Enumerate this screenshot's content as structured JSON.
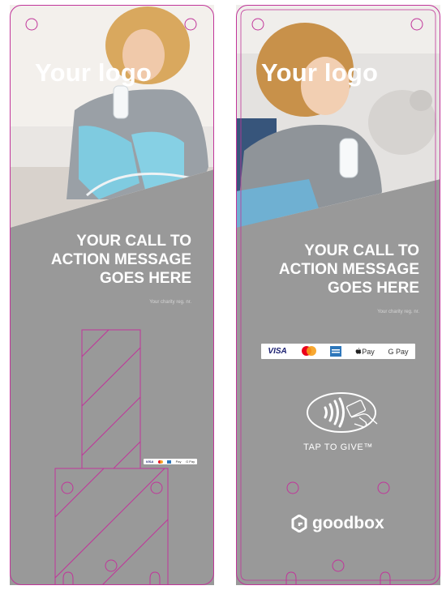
{
  "left_panel": {
    "logo_text": "Your logo",
    "cta_lines": [
      "YOUR CALL TO",
      "ACTION MESSAGE",
      "GOES HERE"
    ],
    "charity_reg": "Your charity reg. nr."
  },
  "right_panel": {
    "logo_text": "Your logo",
    "cta_lines": [
      "YOUR CALL TO",
      "ACTION MESSAGE",
      "GOES HERE"
    ],
    "charity_reg": "Your charity reg. nr.",
    "payment_methods": {
      "visa": "VISA",
      "mastercard": "mastercard",
      "amex": "AMEX",
      "apple_pay": "Pay",
      "google_pay": "G Pay"
    },
    "tap_label": "TAP TO GIVE™",
    "brand_name": "goodbox"
  },
  "colors": {
    "panel_gray": "#999999",
    "outline_magenta": "#c1359a",
    "text_white": "#ffffff"
  },
  "icons": [
    "contactless-icon",
    "hand-card-icon",
    "goodbox-logo-icon",
    "apple-icon",
    "mastercard-icon"
  ]
}
